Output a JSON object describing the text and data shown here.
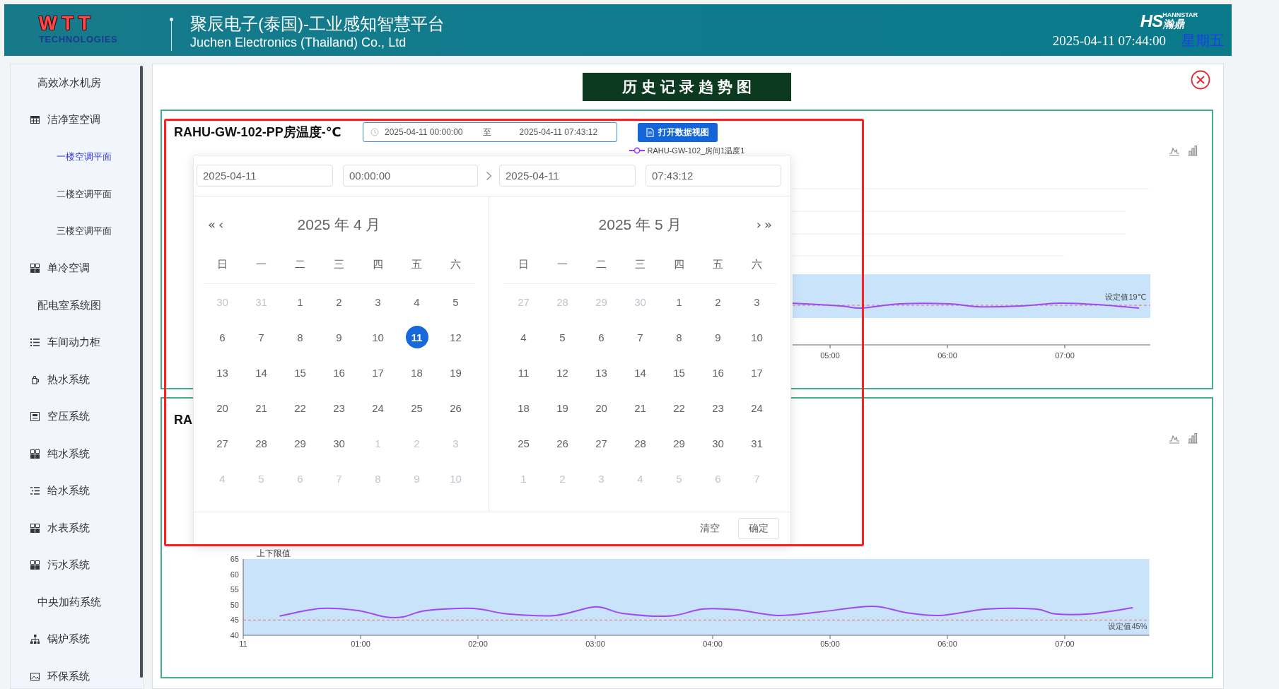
{
  "header": {
    "logo": {
      "mark": "WTT",
      "tagline": "TECHNOLOGIES"
    },
    "title": "聚辰电子(泰国)-工业感知智慧平台",
    "subtitle": "Juchen Electronics (Thailand) Co., Ltd",
    "brand": {
      "mark": "HS",
      "name": "瀚鼎",
      "tagline": "HANNSTAR"
    },
    "datetime": "2025-04-11 07:44:00",
    "weekday": "星期五"
  },
  "sidebar": {
    "items": [
      {
        "label": "高效冰水机房",
        "kind": "plain",
        "selected": false
      },
      {
        "label": "洁净室空调",
        "kind": "table",
        "selected": false,
        "children": [
          {
            "label": "一楼空调平面",
            "selected": true
          },
          {
            "label": "二楼空调平面",
            "selected": false
          },
          {
            "label": "三楼空调平面",
            "selected": false
          }
        ]
      },
      {
        "label": "单冷空调",
        "kind": "tiles",
        "selected": false
      },
      {
        "label": "配电室系统图",
        "kind": "plain",
        "selected": false
      },
      {
        "label": "车间动力柜",
        "kind": "list",
        "selected": false
      },
      {
        "label": "热水系统",
        "kind": "kettle",
        "selected": false
      },
      {
        "label": "空压系统",
        "kind": "panel",
        "selected": false
      },
      {
        "label": "纯水系统",
        "kind": "tiles",
        "selected": false
      },
      {
        "label": "给水系统",
        "kind": "indent",
        "selected": false
      },
      {
        "label": "水表系统",
        "kind": "tiles",
        "selected": false
      },
      {
        "label": "污水系统",
        "kind": "tiles",
        "selected": false
      },
      {
        "label": "中央加药系统",
        "kind": "plain",
        "selected": false
      },
      {
        "label": "锅炉系统",
        "kind": "tree",
        "selected": false
      },
      {
        "label": "环保系统",
        "kind": "image",
        "selected": false
      }
    ]
  },
  "panel": {
    "title": "历史记录趋势图",
    "charts": [
      {
        "title": "RAHU-GW-102-PP房温度-℃",
        "range": {
          "start": "2025-04-11 00:00:00",
          "separator": "至",
          "end": "2025-04-11 07:43:12",
          "focused": true
        },
        "action": "打开数据视图",
        "legend": [
          "RAHU-GW-102_房间1温度1"
        ],
        "plot": {
          "x_labels": [
            "05:00",
            "06:00",
            "07:00"
          ],
          "setpoint_label": "设定值19℃"
        }
      },
      {
        "title": "RA",
        "band": {
          "label": "上下限值"
        },
        "axis_date_label": "11",
        "chart_data": {
          "type": "line",
          "x": [
            0,
            0.31,
            0.66,
            0.98,
            1.21,
            1.36,
            1.56,
            1.96,
            2.25,
            2.66,
            3,
            3.23,
            3.63,
            3.92,
            4.21,
            4.55,
            4.9,
            5.36,
            5.65,
            5.94,
            6.34,
            6.75,
            6.92,
            7.21,
            7.58,
            7.72
          ],
          "series": [
            {
              "color": "#a347f5",
              "line_style": "solid",
              "values": [
                null,
                46.3,
                48.8,
                48.1,
                46.0,
                46.0,
                48.1,
                48.8,
                47.0,
                46.5,
                49.3,
                47.2,
                46.3,
                48.6,
                48.3,
                46.5,
                47.6,
                49.5,
                47.4,
                46.5,
                48.6,
                48.6,
                47.0,
                47.0,
                49.0,
                null
              ]
            },
            {
              "name": "设定值45%",
              "color": "#e66a6a",
              "line_style": "dashed",
              "values": [
                45,
                45,
                45,
                45,
                45,
                45,
                45,
                45,
                45,
                45,
                45,
                45,
                45,
                45,
                45,
                45,
                45,
                45,
                45,
                45,
                45,
                45,
                45,
                45,
                45,
                45
              ]
            }
          ],
          "xlim": [
            0,
            7.72
          ],
          "ylim": [
            40,
            65
          ],
          "xticks": [
            {
              "value": 1,
              "label": "01:00"
            },
            {
              "value": 2,
              "label": "02:00"
            },
            {
              "value": 3,
              "label": "03:00"
            },
            {
              "value": 4,
              "label": "04:00"
            },
            {
              "value": 5,
              "label": "05:00"
            },
            {
              "value": 6,
              "label": "06:00"
            },
            {
              "value": 7,
              "label": "07:00"
            }
          ],
          "yticks": [
            40,
            45,
            50,
            55,
            60,
            65
          ]
        }
      }
    ]
  },
  "date_picker": {
    "start_date": "2025-04-11",
    "start_time": "00:00:00",
    "end_date": "2025-04-11",
    "end_time": "07:43:12",
    "prev": [
      "«",
      "‹"
    ],
    "next": [
      "›",
      "»"
    ],
    "months": [
      {
        "title": "2025 年 4 月",
        "weekdays": [
          "日",
          "一",
          "二",
          "三",
          "四",
          "五",
          "六"
        ],
        "weeks": [
          [
            {
              "day": "30",
              "outside": true,
              "selected": false
            },
            {
              "day": "31",
              "outside": true,
              "selected": false
            },
            {
              "day": "1",
              "outside": false,
              "selected": false
            },
            {
              "day": "2",
              "outside": false,
              "selected": false
            },
            {
              "day": "3",
              "outside": false,
              "selected": false
            },
            {
              "day": "4",
              "outside": false,
              "selected": false
            },
            {
              "day": "5",
              "outside": false,
              "selected": false
            }
          ],
          [
            {
              "day": "6",
              "outside": false,
              "selected": false
            },
            {
              "day": "7",
              "outside": false,
              "selected": false
            },
            {
              "day": "8",
              "outside": false,
              "selected": false
            },
            {
              "day": "9",
              "outside": false,
              "selected": false
            },
            {
              "day": "10",
              "outside": false,
              "selected": false
            },
            {
              "day": "11",
              "outside": false,
              "selected": true
            },
            {
              "day": "12",
              "outside": false,
              "selected": false
            }
          ],
          [
            {
              "day": "13",
              "outside": false,
              "selected": false
            },
            {
              "day": "14",
              "outside": false,
              "selected": false
            },
            {
              "day": "15",
              "outside": false,
              "selected": false
            },
            {
              "day": "16",
              "outside": false,
              "selected": false
            },
            {
              "day": "17",
              "outside": false,
              "selected": false
            },
            {
              "day": "18",
              "outside": false,
              "selected": false
            },
            {
              "day": "19",
              "outside": false,
              "selected": false
            }
          ],
          [
            {
              "day": "20",
              "outside": false,
              "selected": false
            },
            {
              "day": "21",
              "outside": false,
              "selected": false
            },
            {
              "day": "22",
              "outside": false,
              "selected": false
            },
            {
              "day": "23",
              "outside": false,
              "selected": false
            },
            {
              "day": "24",
              "outside": false,
              "selected": false
            },
            {
              "day": "25",
              "outside": false,
              "selected": false
            },
            {
              "day": "26",
              "outside": false,
              "selected": false
            }
          ],
          [
            {
              "day": "27",
              "outside": false,
              "selected": false
            },
            {
              "day": "28",
              "outside": false,
              "selected": false
            },
            {
              "day": "29",
              "outside": false,
              "selected": false
            },
            {
              "day": "30",
              "outside": false,
              "selected": false
            },
            {
              "day": "1",
              "outside": true,
              "selected": false
            },
            {
              "day": "2",
              "outside": true,
              "selected": false
            },
            {
              "day": "3",
              "outside": true,
              "selected": false
            }
          ],
          [
            {
              "day": "4",
              "outside": true,
              "selected": false
            },
            {
              "day": "5",
              "outside": true,
              "selected": false
            },
            {
              "day": "6",
              "outside": true,
              "selected": false
            },
            {
              "day": "7",
              "outside": true,
              "selected": false
            },
            {
              "day": "8",
              "outside": true,
              "selected": false
            },
            {
              "day": "9",
              "outside": true,
              "selected": false
            },
            {
              "day": "10",
              "outside": true,
              "selected": false
            }
          ]
        ]
      },
      {
        "title": "2025 年 5 月",
        "weekdays": [
          "日",
          "一",
          "二",
          "三",
          "四",
          "五",
          "六"
        ],
        "weeks": [
          [
            {
              "day": "27",
              "outside": true,
              "selected": false
            },
            {
              "day": "28",
              "outside": true,
              "selected": false
            },
            {
              "day": "29",
              "outside": true,
              "selected": false
            },
            {
              "day": "30",
              "outside": true,
              "selected": false
            },
            {
              "day": "1",
              "outside": false,
              "selected": false
            },
            {
              "day": "2",
              "outside": false,
              "selected": false
            },
            {
              "day": "3",
              "outside": false,
              "selected": false
            }
          ],
          [
            {
              "day": "4",
              "outside": false,
              "selected": false
            },
            {
              "day": "5",
              "outside": false,
              "selected": false
            },
            {
              "day": "6",
              "outside": false,
              "selected": false
            },
            {
              "day": "7",
              "outside": false,
              "selected": false
            },
            {
              "day": "8",
              "outside": false,
              "selected": false
            },
            {
              "day": "9",
              "outside": false,
              "selected": false
            },
            {
              "day": "10",
              "outside": false,
              "selected": false
            }
          ],
          [
            {
              "day": "11",
              "outside": false,
              "selected": false
            },
            {
              "day": "12",
              "outside": false,
              "selected": false
            },
            {
              "day": "13",
              "outside": false,
              "selected": false
            },
            {
              "day": "14",
              "outside": false,
              "selected": false
            },
            {
              "day": "15",
              "outside": false,
              "selected": false
            },
            {
              "day": "16",
              "outside": false,
              "selected": false
            },
            {
              "day": "17",
              "outside": false,
              "selected": false
            }
          ],
          [
            {
              "day": "18",
              "outside": false,
              "selected": false
            },
            {
              "day": "19",
              "outside": false,
              "selected": false
            },
            {
              "day": "20",
              "outside": false,
              "selected": false
            },
            {
              "day": "21",
              "outside": false,
              "selected": false
            },
            {
              "day": "22",
              "outside": false,
              "selected": false
            },
            {
              "day": "23",
              "outside": false,
              "selected": false
            },
            {
              "day": "24",
              "outside": false,
              "selected": false
            }
          ],
          [
            {
              "day": "25",
              "outside": false,
              "selected": false
            },
            {
              "day": "26",
              "outside": false,
              "selected": false
            },
            {
              "day": "27",
              "outside": false,
              "selected": false
            },
            {
              "day": "28",
              "outside": false,
              "selected": false
            },
            {
              "day": "29",
              "outside": false,
              "selected": false
            },
            {
              "day": "30",
              "outside": false,
              "selected": false
            },
            {
              "day": "31",
              "outside": false,
              "selected": false
            }
          ],
          [
            {
              "day": "1",
              "outside": true,
              "selected": false
            },
            {
              "day": "2",
              "outside": true,
              "selected": false
            },
            {
              "day": "3",
              "outside": true,
              "selected": false
            },
            {
              "day": "4",
              "outside": true,
              "selected": false
            },
            {
              "day": "5",
              "outside": true,
              "selected": false
            },
            {
              "day": "6",
              "outside": true,
              "selected": false
            },
            {
              "day": "7",
              "outside": true,
              "selected": false
            }
          ]
        ]
      }
    ],
    "clear": "清空",
    "confirm": "确定"
  }
}
